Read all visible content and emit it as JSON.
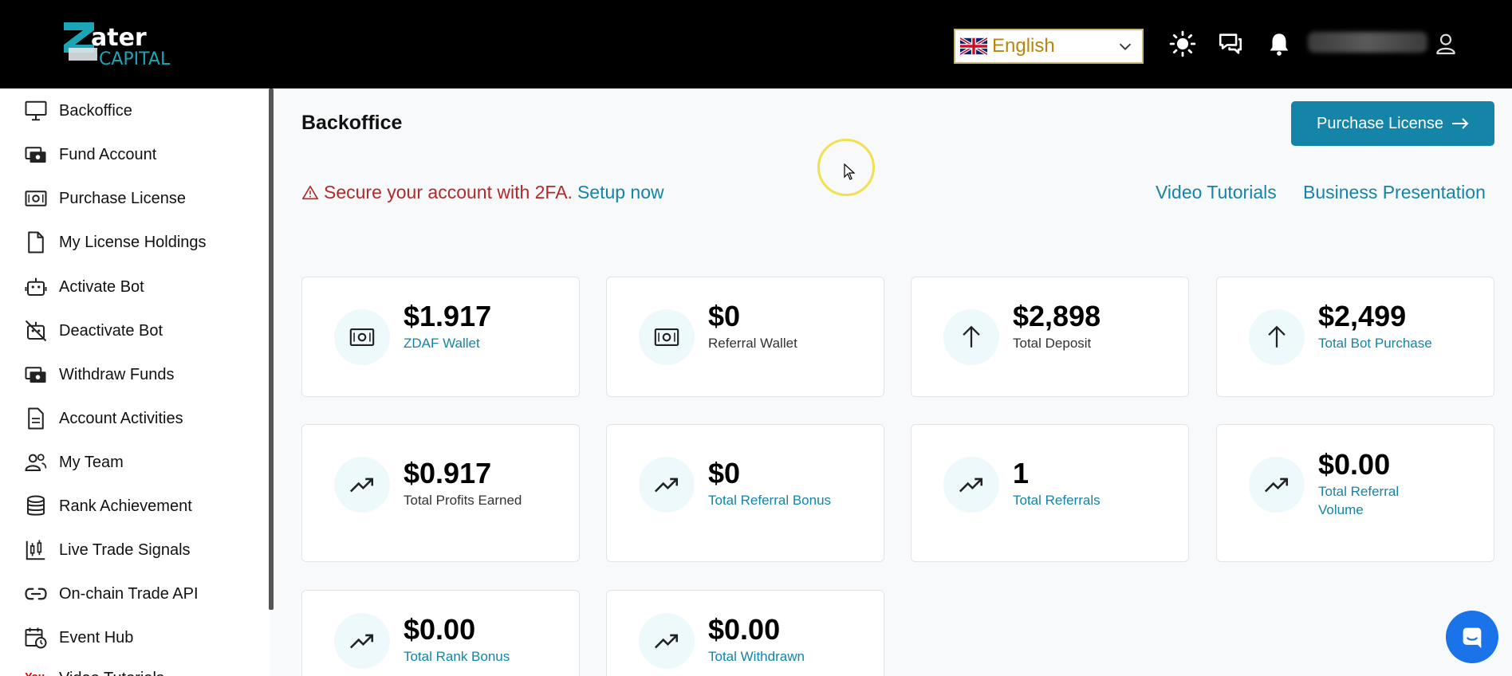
{
  "header": {
    "logo_text_1": "ater",
    "logo_text_2": "CAPITAL",
    "language": "English"
  },
  "sidebar": {
    "items": [
      {
        "label": "Backoffice",
        "icon": "monitor-icon"
      },
      {
        "label": "Fund Account",
        "icon": "wallet-icon"
      },
      {
        "label": "Purchase License",
        "icon": "cash-icon"
      },
      {
        "label": "My License Holdings",
        "icon": "file-icon"
      },
      {
        "label": "Activate Bot",
        "icon": "robot-icon"
      },
      {
        "label": "Deactivate Bot",
        "icon": "robot-off-icon"
      },
      {
        "label": "Withdraw Funds",
        "icon": "wallet-icon"
      },
      {
        "label": "Account Activities",
        "icon": "document-icon"
      },
      {
        "label": "My Team",
        "icon": "users-icon"
      },
      {
        "label": "Rank Achievement",
        "icon": "database-icon"
      },
      {
        "label": "Live Trade Signals",
        "icon": "candles-icon"
      },
      {
        "label": "On-chain Trade API",
        "icon": "link-icon"
      },
      {
        "label": "Event Hub",
        "icon": "calendar-clock-icon"
      },
      {
        "label": "Video Tutorials",
        "icon": "youtube-icon"
      }
    ]
  },
  "main": {
    "title": "Backoffice",
    "purchase_button": "Purchase License",
    "alert_text": "Secure your account with 2FA.",
    "alert_link": "Setup now",
    "link_video": "Video Tutorials",
    "link_business": "Business Presentation",
    "cards": [
      {
        "value": "$1.917",
        "label": "ZDAF Wallet",
        "icon": "cash-icon",
        "label_color": "teal"
      },
      {
        "value": "$0",
        "label": "Referral Wallet",
        "icon": "cash-icon",
        "label_color": "dark"
      },
      {
        "value": "$2,898",
        "label": "Total Deposit",
        "icon": "arrow-up-icon",
        "label_color": "dark"
      },
      {
        "value": "$2,499",
        "label": "Total Bot Purchase",
        "icon": "arrow-up-icon",
        "label_color": "teal"
      },
      {
        "value": "$0.917",
        "label": "Total Profits Earned",
        "icon": "trending-up-icon",
        "label_color": "dark"
      },
      {
        "value": "$0",
        "label": "Total Referral Bonus",
        "icon": "trending-up-icon",
        "label_color": "teal"
      },
      {
        "value": "1",
        "label": "Total Referrals",
        "icon": "trending-up-icon",
        "label_color": "teal"
      },
      {
        "value": "$0.00",
        "label": "Total Referral Volume",
        "icon": "trending-up-icon",
        "label_color": "teal"
      },
      {
        "value": "$0.00",
        "label": "Total Rank Bonus",
        "icon": "trending-up-icon",
        "label_color": "teal"
      },
      {
        "value": "$0.00",
        "label": "Total Withdrawn",
        "icon": "trending-up-icon",
        "label_color": "teal"
      }
    ]
  },
  "colors": {
    "accent": "#1484a8",
    "alert": "#b02a2a",
    "topbar": "#000000"
  }
}
